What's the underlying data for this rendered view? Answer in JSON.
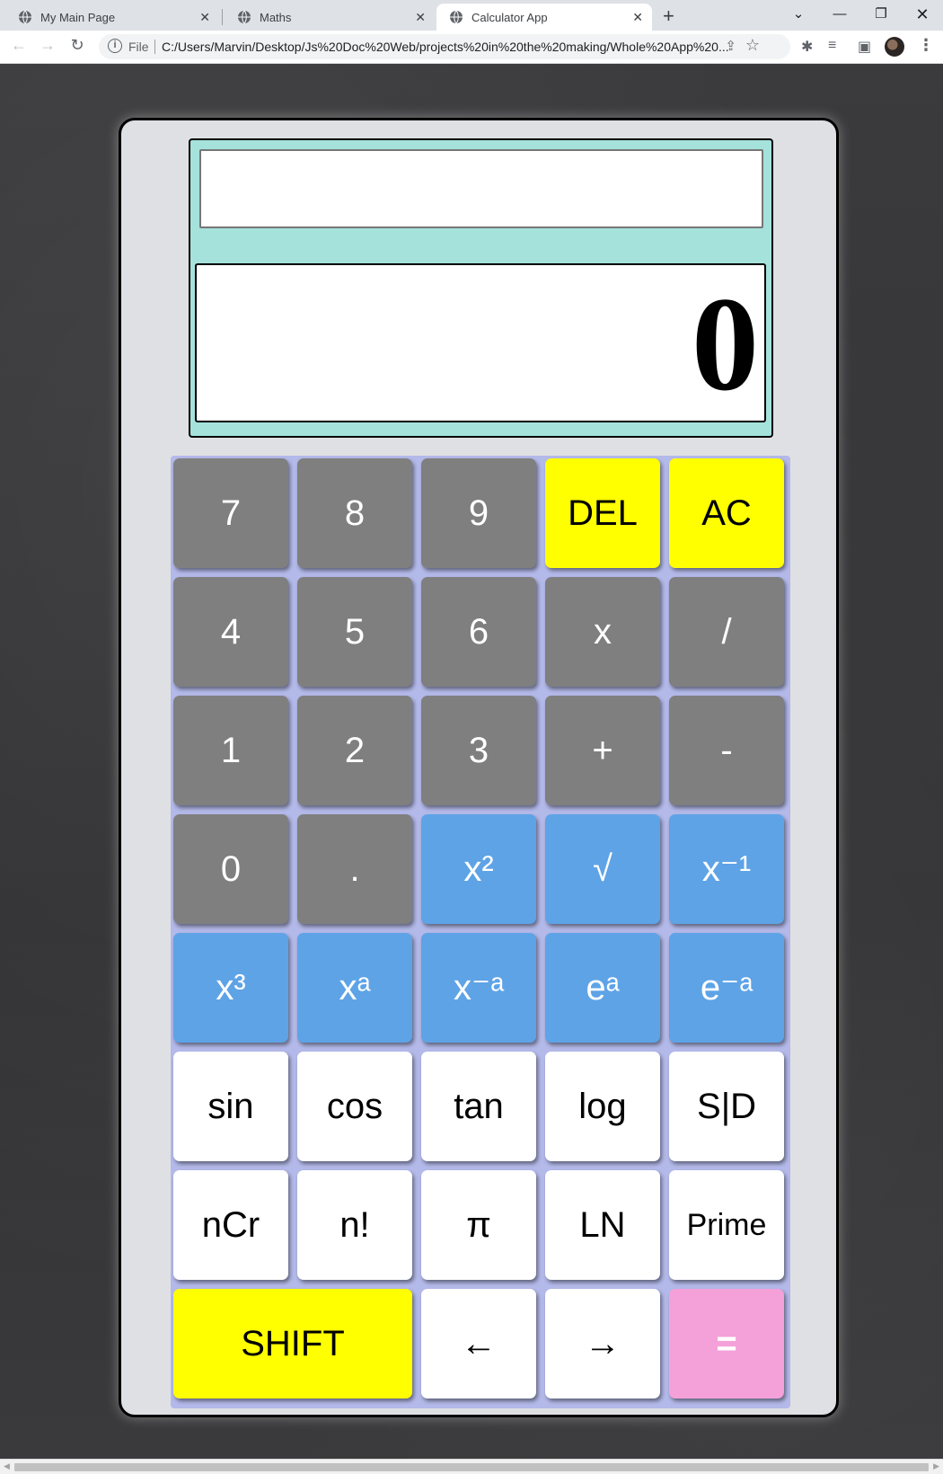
{
  "browser": {
    "tabs": [
      {
        "title": "My Main Page"
      },
      {
        "title": "Maths"
      },
      {
        "title": "Calculator App"
      }
    ],
    "address": {
      "label": "File",
      "url": "C:/Users/Marvin/Desktop/Js%20Doc%20Web/projects%20in%20the%20making/Whole%20App%20..."
    }
  },
  "calculator": {
    "input_value": "",
    "result_value": "0",
    "keys": {
      "seven": "7",
      "eight": "8",
      "nine": "9",
      "del": "DEL",
      "ac": "AC",
      "four": "4",
      "five": "5",
      "six": "6",
      "multiply": "x",
      "divide": "/",
      "one": "1",
      "two": "2",
      "three": "3",
      "plus": "+",
      "minus": "-",
      "zero": "0",
      "decimal": ".",
      "square": "x²",
      "sqrt": "√",
      "inverse": "x⁻¹",
      "cube": "x³",
      "power": "xᵃ",
      "neg_power": "x⁻ᵃ",
      "exp": "eᵃ",
      "neg_exp": "e⁻ᵃ",
      "sin": "sin",
      "cos": "cos",
      "tan": "tan",
      "log": "log",
      "sd": "S|D",
      "ncr": "nCr",
      "factorial": "n!",
      "pi": "π",
      "ln": "LN",
      "prime": "Prime",
      "shift": "SHIFT",
      "left": "←",
      "right": "→",
      "equals": "="
    }
  },
  "colors": {
    "number_key": "#7f7f7f",
    "control_key": "#ffff00",
    "power_key": "#5ea3e6",
    "function_key": "#ffffff",
    "equals_key": "#f4a1d9",
    "screen": "#a5e2dc",
    "keypad": "#b3b9e9"
  }
}
